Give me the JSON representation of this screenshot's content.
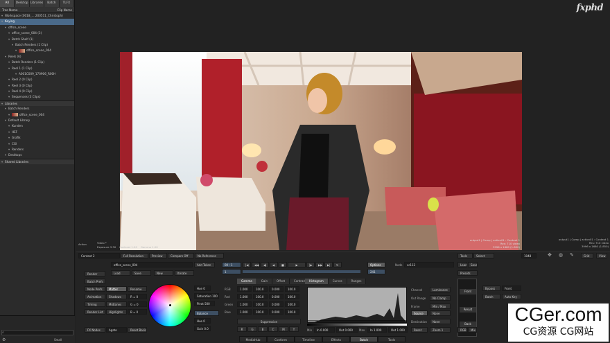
{
  "logo": "fxphd",
  "left": {
    "tabs": [
      "All",
      "Desktop",
      "Libraries",
      "Batch",
      "TLFX"
    ],
    "header": {
      "left": "Tree Name",
      "right": "Clip Name"
    },
    "tree": [
      {
        "text": "Workspace (0018_... 200511_Christoph)",
        "indent": 0,
        "style": "plain"
      },
      {
        "text": "Keying",
        "indent": 0,
        "style": "sel"
      },
      {
        "text": "office_scene",
        "indent": 1,
        "style": "plain"
      },
      {
        "text": "office_scene_004 (3)",
        "indent": 2,
        "style": "plain"
      },
      {
        "text": "Batch Shelf (1)",
        "indent": 2,
        "style": "plain"
      },
      {
        "text": "Batch Renders (1 Clip)",
        "indent": 3,
        "style": "plain"
      },
      {
        "text": "office_scene_004",
        "indent": 4,
        "style": "thumb"
      },
      {
        "text": "Reels (6)",
        "indent": 1,
        "style": "plain"
      },
      {
        "text": "Batch Renders (1 Clip)",
        "indent": 2,
        "style": "plain"
      },
      {
        "text": "Reel 1 (1 Clip)",
        "indent": 2,
        "style": "plain"
      },
      {
        "text": "A001C009_170906_R00H",
        "indent": 4,
        "style": "plain"
      },
      {
        "text": "Reel 2 (0 Clip)",
        "indent": 2,
        "style": "plain"
      },
      {
        "text": "Reel 3 (0 Clip)",
        "indent": 2,
        "style": "plain"
      },
      {
        "text": "Reel 4 (0 Clip)",
        "indent": 2,
        "style": "plain"
      },
      {
        "text": "Sequences (3 Clips)",
        "indent": 2,
        "style": "plain"
      },
      {
        "text": "Libraries",
        "indent": 0,
        "style": "sec"
      },
      {
        "text": "Batch Renders",
        "indent": 1,
        "style": "plain"
      },
      {
        "text": "office_scene_004",
        "indent": 2,
        "style": "thumb"
      },
      {
        "text": "Default Library",
        "indent": 1,
        "style": "plain"
      },
      {
        "text": "Kunden",
        "indent": 2,
        "style": "plain"
      },
      {
        "text": "HEF",
        "indent": 2,
        "style": "plain"
      },
      {
        "text": "Grafik",
        "indent": 2,
        "style": "plain"
      },
      {
        "text": "CGI",
        "indent": 2,
        "style": "plain"
      },
      {
        "text": "Renders",
        "indent": 2,
        "style": "plain"
      },
      {
        "text": "Desktops",
        "indent": 1,
        "style": "plain"
      },
      {
        "text": "Shared Libraries",
        "indent": 0,
        "style": "sec"
      }
    ],
    "bottom_label": "Small"
  },
  "viewer": {
    "top_right_info": [
      "output1 | Comp | action01 : Context 1",
      "Res: 710 video",
      "3996 x 1680 (1.850)"
    ],
    "bottom_left": {
      "mode": "Action",
      "video": "Video *",
      "exposure": "Exposure 3.30",
      "contrast": "Contrast 1.00",
      "gamma": "Gamma 1.00"
    }
  },
  "toolbar": {
    "context": "Context 2",
    "resolution": "Full Resolution",
    "preview": "Preview",
    "compare": "Compare Off",
    "reference": "No Reference",
    "tools": "Tools",
    "select": "Select",
    "frame": "1048",
    "grid": "Grid",
    "view": "View"
  },
  "batch": {
    "name": "office_scene_004",
    "add_token": "Add Token",
    "render": "Render",
    "batch_prefs": "Batch Prefs",
    "load": "Load",
    "save": "Save",
    "new": "New",
    "iterate": "Iterate",
    "node_prefs": "Node Prefs",
    "matter": "Matter",
    "rename": "Rename",
    "animation": "Animation",
    "shadows": "Shadows",
    "timing": "Timing",
    "midtones": "Midtones",
    "render_list": "Render List",
    "highlights": "Highlights",
    "fx_nodes": "FX Nodes",
    "agate": "Agate",
    "reset_basics": "Reset Basics",
    "r_val": "R = 0",
    "g_val": "G = 0",
    "b_val": "B = 0"
  },
  "transport": {
    "timecode": "00 : 1",
    "in": "1",
    "out": "241",
    "options": "Options",
    "node_label": "Node",
    "node_value": "cc112",
    "load": "Load",
    "save": "Save",
    "presets": "Presets"
  },
  "color": {
    "hue_label": "Hue",
    "hue_value": "0",
    "saturation": "Saturation 100",
    "pivot": "Pivot 500",
    "balance": "Balance",
    "hue2": "Hue 0",
    "gain": "Gain 0.0",
    "tabs": [
      "Gamma",
      "Gain",
      "Offset",
      "Contrast"
    ],
    "rows": [
      {
        "label": "RGB",
        "values": [
          "1.000",
          "100.0",
          "0.000",
          "100.0"
        ]
      },
      {
        "label": "Red",
        "values": [
          "1.000",
          "100.0",
          "0.000",
          "100.0"
        ]
      },
      {
        "label": "Green",
        "values": [
          "1.000",
          "100.0",
          "0.000",
          "100.0"
        ]
      },
      {
        "label": "Blue",
        "values": [
          "1.000",
          "100.0",
          "0.000",
          "100.0"
        ]
      }
    ],
    "suppression": "Suppression",
    "supp_letters": [
      "R",
      "G",
      "B",
      "C",
      "M",
      "Y"
    ]
  },
  "histogram": {
    "tabs": [
      "Histogram",
      "Curves",
      "Ranges"
    ],
    "in_low": "In 0.000",
    "out_low": "Out 0.000",
    "in_high": "In 1.000",
    "out_high": "Out 1.000",
    "min_label": "Min",
    "max_label": "Max"
  },
  "channel": {
    "channel": "Channel",
    "luminance": "Luminance",
    "out_range": "Out Range",
    "no_clamp": "No Clamp",
    "frame": "Frame",
    "min_max": "Min / Max",
    "source": "Source",
    "none": "None",
    "destination": "Destination",
    "none2": "None",
    "reset": "Reset",
    "zoom": "Zoom 1"
  },
  "side": {
    "front": "Front",
    "back": "Back",
    "result": "Result",
    "rgb": "RGB",
    "mix": "Mix",
    "bypass": "Bypass",
    "front2": "Front",
    "batch": "Batch",
    "auto_key": "Auto Key"
  },
  "bottom_tabs": [
    "MediaHub",
    "Conform",
    "Timeline",
    "Effects",
    "Batch",
    "Tools"
  ],
  "watermark": {
    "title": "CGer.com",
    "subtitle": "CG资源 CG网站"
  }
}
